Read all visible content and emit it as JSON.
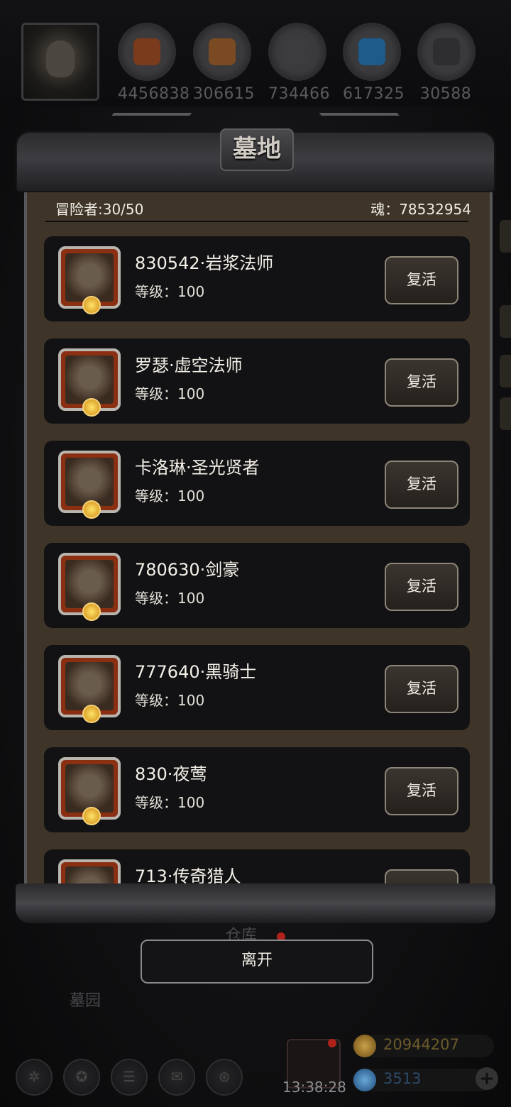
{
  "resources": [
    {
      "icon": "meat-icon",
      "value": "4456838",
      "color": "#7a3a1c"
    },
    {
      "icon": "wood-icon",
      "value": "306615",
      "color": "#7a4a22"
    },
    {
      "icon": "iron-icon",
      "value": "734466",
      "color": "#3c3c3e"
    },
    {
      "icon": "crystal-icon",
      "value": "617325",
      "color": "#1e5a8a"
    },
    {
      "icon": "ingot-icon",
      "value": "30588",
      "color": "#2e2e30"
    }
  ],
  "panel": {
    "title": "墓地",
    "adventurers": "冒险者:30/50",
    "souls": "魂：78532954",
    "revive_label": "复活",
    "heroes": [
      {
        "name": "830542·岩浆法师",
        "level": "等级：100"
      },
      {
        "name": "罗瑟·虚空法师",
        "level": "等级：100"
      },
      {
        "name": "卡洛琳·圣光贤者",
        "level": "等级：100"
      },
      {
        "name": "780630·剑豪",
        "level": "等级：100"
      },
      {
        "name": "777640·黑骑士",
        "level": "等级：100"
      },
      {
        "name": "830·夜莺",
        "level": "等级：100"
      },
      {
        "name": "713·传奇猎人",
        "level": ""
      }
    ]
  },
  "leave_label": "离开",
  "background": {
    "warehouse": "仓库",
    "cemetery": "墓园"
  },
  "bottom": {
    "time": "13:38:28",
    "gold": "20944207",
    "gems": "3513"
  }
}
